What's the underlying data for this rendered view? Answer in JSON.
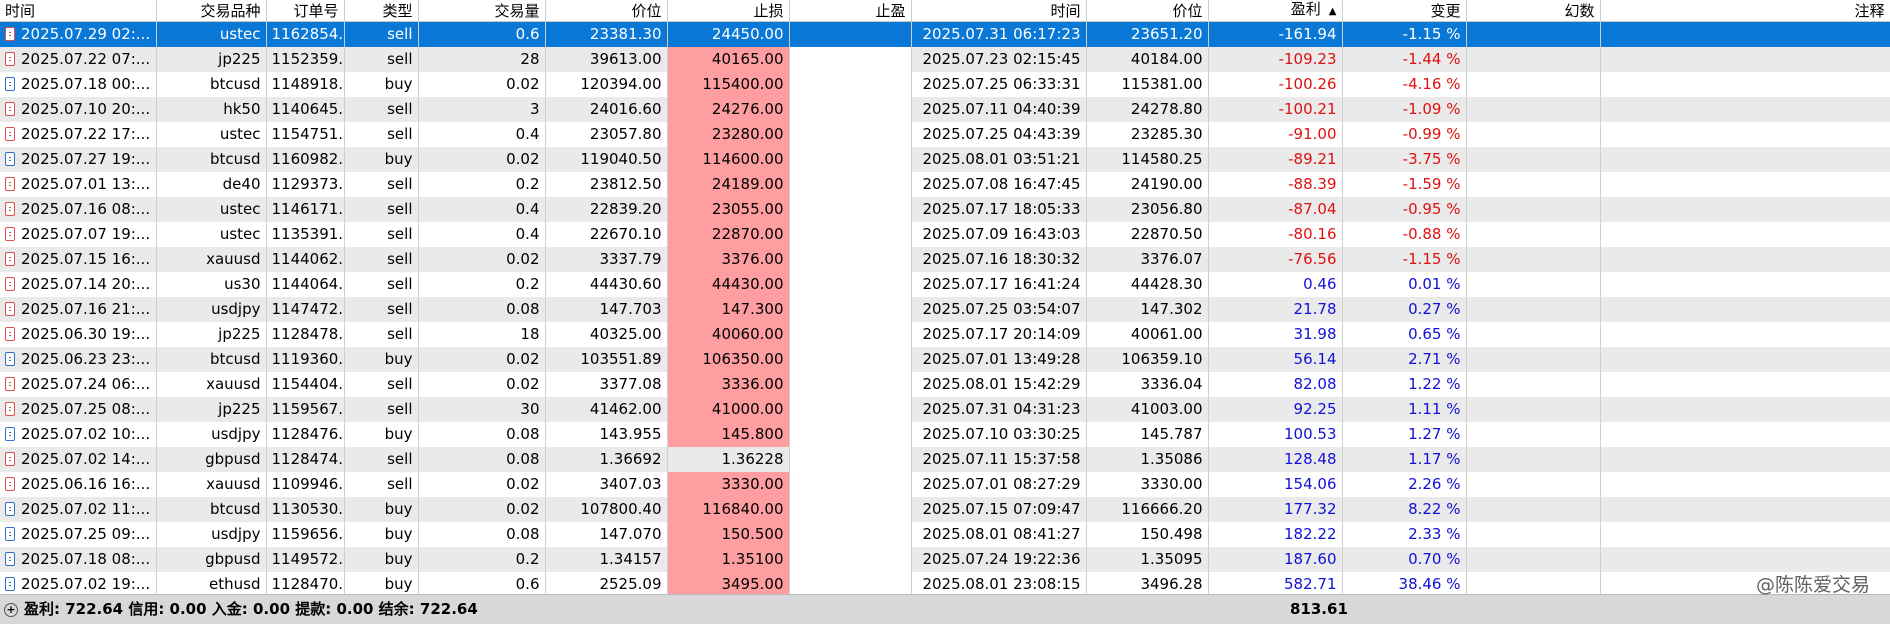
{
  "columns": {
    "time": "时间",
    "symbol": "交易品种",
    "ticket": "订单号",
    "type": "类型",
    "volume": "交易量",
    "price": "价位",
    "sl": "止损",
    "tp": "止盈",
    "close_time": "时间",
    "close_price": "价位",
    "profit": "盈利",
    "change": "变更",
    "magic": "幻数",
    "comment": "注释"
  },
  "rows": [
    {
      "time": "2025.07.29 02:...",
      "symbol": "ustec",
      "ticket": "1162854...",
      "type": "sell",
      "volume": "0.6",
      "price": "23381.30",
      "sl": "24450.00",
      "tp": "",
      "close_time": "2025.07.31 06:17:23",
      "close_price": "23651.20",
      "profit": "-161.94",
      "change": "-1.15 %"
    },
    {
      "time": "2025.07.22 07:...",
      "symbol": "jp225",
      "ticket": "1152359...",
      "type": "sell",
      "volume": "28",
      "price": "39613.00",
      "sl": "40165.00",
      "tp": "",
      "close_time": "2025.07.23 02:15:45",
      "close_price": "40184.00",
      "profit": "-109.23",
      "change": "-1.44 %"
    },
    {
      "time": "2025.07.18 00:...",
      "symbol": "btcusd",
      "ticket": "1148918...",
      "type": "buy",
      "volume": "0.02",
      "price": "120394.00",
      "sl": "115400.00",
      "tp": "",
      "close_time": "2025.07.25 06:33:31",
      "close_price": "115381.00",
      "profit": "-100.26",
      "change": "-4.16 %"
    },
    {
      "time": "2025.07.10 20:...",
      "symbol": "hk50",
      "ticket": "1140645...",
      "type": "sell",
      "volume": "3",
      "price": "24016.60",
      "sl": "24276.00",
      "tp": "",
      "close_time": "2025.07.11 04:40:39",
      "close_price": "24278.80",
      "profit": "-100.21",
      "change": "-1.09 %"
    },
    {
      "time": "2025.07.22 17:...",
      "symbol": "ustec",
      "ticket": "1154751...",
      "type": "sell",
      "volume": "0.4",
      "price": "23057.80",
      "sl": "23280.00",
      "tp": "",
      "close_time": "2025.07.25 04:43:39",
      "close_price": "23285.30",
      "profit": "-91.00",
      "change": "-0.99 %"
    },
    {
      "time": "2025.07.27 19:...",
      "symbol": "btcusd",
      "ticket": "1160982...",
      "type": "buy",
      "volume": "0.02",
      "price": "119040.50",
      "sl": "114600.00",
      "tp": "",
      "close_time": "2025.08.01 03:51:21",
      "close_price": "114580.25",
      "profit": "-89.21",
      "change": "-3.75 %"
    },
    {
      "time": "2025.07.01 13:...",
      "symbol": "de40",
      "ticket": "1129373...",
      "type": "sell",
      "volume": "0.2",
      "price": "23812.50",
      "sl": "24189.00",
      "tp": "",
      "close_time": "2025.07.08 16:47:45",
      "close_price": "24190.00",
      "profit": "-88.39",
      "change": "-1.59 %"
    },
    {
      "time": "2025.07.16 08:...",
      "symbol": "ustec",
      "ticket": "1146171...",
      "type": "sell",
      "volume": "0.4",
      "price": "22839.20",
      "sl": "23055.00",
      "tp": "",
      "close_time": "2025.07.17 18:05:33",
      "close_price": "23056.80",
      "profit": "-87.04",
      "change": "-0.95 %"
    },
    {
      "time": "2025.07.07 19:...",
      "symbol": "ustec",
      "ticket": "1135391...",
      "type": "sell",
      "volume": "0.4",
      "price": "22670.10",
      "sl": "22870.00",
      "tp": "",
      "close_time": "2025.07.09 16:43:03",
      "close_price": "22870.50",
      "profit": "-80.16",
      "change": "-0.88 %"
    },
    {
      "time": "2025.07.15 16:...",
      "symbol": "xauusd",
      "ticket": "1144062...",
      "type": "sell",
      "volume": "0.02",
      "price": "3337.79",
      "sl": "3376.00",
      "tp": "",
      "close_time": "2025.07.16 18:30:32",
      "close_price": "3376.07",
      "profit": "-76.56",
      "change": "-1.15 %"
    },
    {
      "time": "2025.07.14 20:...",
      "symbol": "us30",
      "ticket": "1144064...",
      "type": "sell",
      "volume": "0.2",
      "price": "44430.60",
      "sl": "44430.00",
      "tp": "",
      "close_time": "2025.07.17 16:41:24",
      "close_price": "44428.30",
      "profit": "0.46",
      "change": "0.01 %"
    },
    {
      "time": "2025.07.16 21:...",
      "symbol": "usdjpy",
      "ticket": "1147472...",
      "type": "sell",
      "volume": "0.08",
      "price": "147.703",
      "sl": "147.300",
      "tp": "",
      "close_time": "2025.07.25 03:54:07",
      "close_price": "147.302",
      "profit": "21.78",
      "change": "0.27 %"
    },
    {
      "time": "2025.06.30 19:...",
      "symbol": "jp225",
      "ticket": "1128478...",
      "type": "sell",
      "volume": "18",
      "price": "40325.00",
      "sl": "40060.00",
      "tp": "",
      "close_time": "2025.07.17 20:14:09",
      "close_price": "40061.00",
      "profit": "31.98",
      "change": "0.65 %"
    },
    {
      "time": "2025.06.23 23:...",
      "symbol": "btcusd",
      "ticket": "1119360...",
      "type": "buy",
      "volume": "0.02",
      "price": "103551.89",
      "sl": "106350.00",
      "tp": "",
      "close_time": "2025.07.01 13:49:28",
      "close_price": "106359.10",
      "profit": "56.14",
      "change": "2.71 %"
    },
    {
      "time": "2025.07.24 06:...",
      "symbol": "xauusd",
      "ticket": "1154404...",
      "type": "sell",
      "volume": "0.02",
      "price": "3377.08",
      "sl": "3336.00",
      "tp": "",
      "close_time": "2025.08.01 15:42:29",
      "close_price": "3336.04",
      "profit": "82.08",
      "change": "1.22 %"
    },
    {
      "time": "2025.07.25 08:...",
      "symbol": "jp225",
      "ticket": "1159567...",
      "type": "sell",
      "volume": "30",
      "price": "41462.00",
      "sl": "41000.00",
      "tp": "",
      "close_time": "2025.07.31 04:31:23",
      "close_price": "41003.00",
      "profit": "92.25",
      "change": "1.11 %"
    },
    {
      "time": "2025.07.02 10:...",
      "symbol": "usdjpy",
      "ticket": "1128476...",
      "type": "buy",
      "volume": "0.08",
      "price": "143.955",
      "sl": "145.800",
      "tp": "",
      "close_time": "2025.07.10 03:30:25",
      "close_price": "145.787",
      "profit": "100.53",
      "change": "1.27 %"
    },
    {
      "time": "2025.07.02 14:...",
      "symbol": "gbpusd",
      "ticket": "1128474...",
      "type": "sell",
      "volume": "0.08",
      "price": "1.36692",
      "sl": "1.36228",
      "tp": "",
      "close_time": "2025.07.11 15:37:58",
      "close_price": "1.35086",
      "profit": "128.48",
      "change": "1.17 %",
      "sl_plain": true
    },
    {
      "time": "2025.06.16 16:...",
      "symbol": "xauusd",
      "ticket": "1109946...",
      "type": "sell",
      "volume": "0.02",
      "price": "3407.03",
      "sl": "3330.00",
      "tp": "",
      "close_time": "2025.07.01 08:27:29",
      "close_price": "3330.00",
      "profit": "154.06",
      "change": "2.26 %"
    },
    {
      "time": "2025.07.02 11:...",
      "symbol": "btcusd",
      "ticket": "1130530...",
      "type": "buy",
      "volume": "0.02",
      "price": "107800.40",
      "sl": "116840.00",
      "tp": "",
      "close_time": "2025.07.15 07:09:47",
      "close_price": "116666.20",
      "profit": "177.32",
      "change": "8.22 %"
    },
    {
      "time": "2025.07.25 09:...",
      "symbol": "usdjpy",
      "ticket": "1159656...",
      "type": "buy",
      "volume": "0.08",
      "price": "147.070",
      "sl": "150.500",
      "tp": "",
      "close_time": "2025.08.01 08:41:27",
      "close_price": "150.498",
      "profit": "182.22",
      "change": "2.33 %"
    },
    {
      "time": "2025.07.18 08:...",
      "symbol": "gbpusd",
      "ticket": "1149572...",
      "type": "buy",
      "volume": "0.2",
      "price": "1.34157",
      "sl": "1.35100",
      "tp": "",
      "close_time": "2025.07.24 19:22:36",
      "close_price": "1.35095",
      "profit": "187.60",
      "change": "0.70 %"
    },
    {
      "time": "2025.07.02 19:...",
      "symbol": "ethusd",
      "ticket": "1128470...",
      "type": "buy",
      "volume": "0.6",
      "price": "2525.09",
      "sl": "3495.00",
      "tp": "",
      "close_time": "2025.08.01 23:08:15",
      "close_price": "3496.28",
      "profit": "582.71",
      "change": "38.46 %"
    }
  ],
  "footer": {
    "summary": "盈利: 722.64  信用: 0.00  入金: 0.00  提款: 0.00  结余: 722.64",
    "total_profit": "813.61"
  },
  "watermark": "@陈陈爱交易",
  "colors": {
    "selected": "#0a78d7",
    "stoploss": "#ff9ea0",
    "negative": "#e01010",
    "positive": "#1010d8"
  }
}
